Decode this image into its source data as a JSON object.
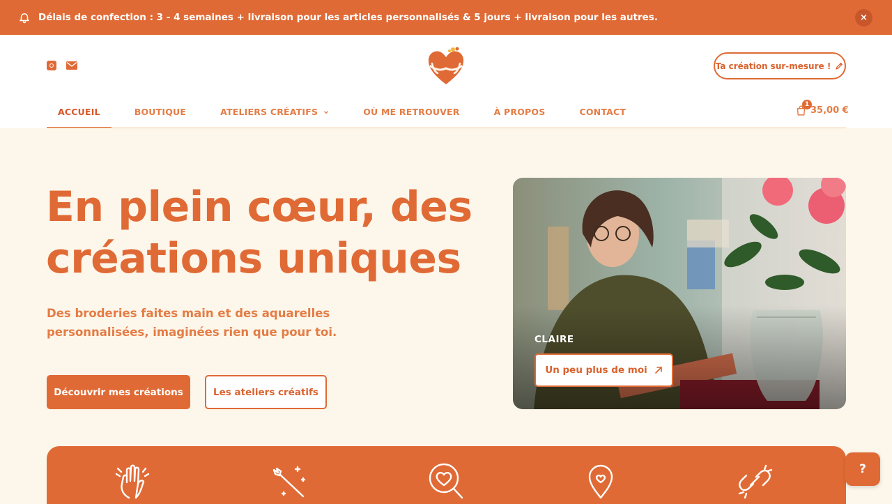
{
  "announcement": {
    "text": "Délais de confection : 3 - 4 semaines + livraison pour les articles personnalisés & 5 jours + livraison pour les autres.",
    "close_label": "×"
  },
  "header": {
    "social": [
      "instagram-icon",
      "mail-icon"
    ],
    "custom_button_label": "Ta création sur-mesure !",
    "cart_count": "1",
    "cart_total": "35,00 €"
  },
  "nav": {
    "items": [
      {
        "label": "ACCUEIL"
      },
      {
        "label": "BOUTIQUE"
      },
      {
        "label": "ATELIERS CRÉATIFS"
      },
      {
        "label": "OÙ ME RETROUVER"
      },
      {
        "label": "À PROPOS"
      },
      {
        "label": "CONTACT"
      }
    ]
  },
  "hero": {
    "title": "En plein cœur, des créations uniques",
    "subtitle": "Des broderies faites main et des aquarelles personnalisées, imaginées rien que pour toi.",
    "primary_button": "Découvrir mes créations",
    "secondary_button": "Les ateliers créatifs",
    "photo_name": "CLAIRE",
    "photo_button": "Un peu plus de moi"
  },
  "features": [
    "hand-icon",
    "magic-wand-icon",
    "heart-search-icon",
    "location-pin-icon",
    "link-icon"
  ],
  "help_label": "?",
  "colors": {
    "accent": "#e06a35",
    "hero_bg": "#fdf6ea",
    "nav_text": "#e47c45"
  }
}
